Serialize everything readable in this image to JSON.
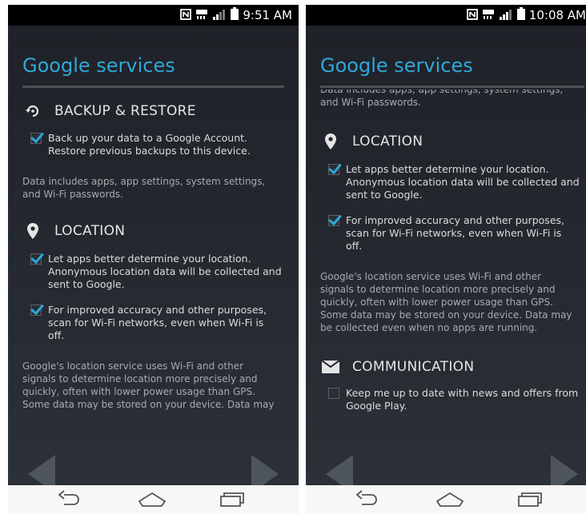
{
  "screens": [
    {
      "time": "9:51 AM",
      "title": "Google services",
      "sections": {
        "backup": {
          "title": "BACKUP & RESTORE",
          "check_line1": "Back up your data to a Google Account.",
          "check_line2": "Restore previous backups to this device.",
          "note_line1": "Data includes apps, app settings, system settings,",
          "note_line2": "and Wi-Fi passwords."
        },
        "location": {
          "title": "LOCATION",
          "item1_line1": "Let apps better determine your location.",
          "item1_line2": "Anonymous location data will be collected and",
          "item1_line3": "sent to Google.",
          "item2_line1": "For improved accuracy and other purposes,",
          "item2_line2": "scan for Wi-Fi networks, even when Wi-Fi is",
          "item2_line3": "off.",
          "para_line1": "Google's location service uses Wi-Fi and other",
          "para_line2": "signals to determine location more precisely and",
          "para_line3": "quickly, often with lower power usage than GPS.",
          "para_line4": "Some data may be stored on your device. Data may"
        }
      }
    },
    {
      "time": "10:08 AM",
      "title": "Google services",
      "partial_line1": "Data includes apps, app settings, system settings,",
      "partial_line2": "and Wi-Fi passwords.",
      "sections": {
        "location": {
          "title": "LOCATION",
          "item1_line1": "Let apps better determine your location.",
          "item1_line2": "Anonymous location data will be collected and",
          "item1_line3": "sent to Google.",
          "item2_line1": "For improved accuracy and other purposes,",
          "item2_line2": "scan for Wi-Fi networks, even when Wi-Fi is",
          "item2_line3": "off.",
          "para_line1": "Google's location service uses Wi-Fi and other",
          "para_line2": "signals to determine location more precisely and",
          "para_line3": "quickly, often with lower power usage than GPS.",
          "para_line4": "Some data may be stored on your device. Data may",
          "para_line5": "be collected even when no apps are running."
        },
        "communication": {
          "title": "COMMUNICATION",
          "item1_line1": "Keep me up to date with news and offers from",
          "item1_line2": "Google Play."
        }
      }
    }
  ],
  "status_icons": [
    "nfc-icon",
    "lte-icon",
    "signal-icon",
    "battery-icon"
  ],
  "nav_icons": [
    "back-icon",
    "home-icon",
    "recents-icon"
  ],
  "colors": {
    "accent": "#2fa8d9",
    "background": "#23262c",
    "checkbox": "#2fa8d9"
  }
}
